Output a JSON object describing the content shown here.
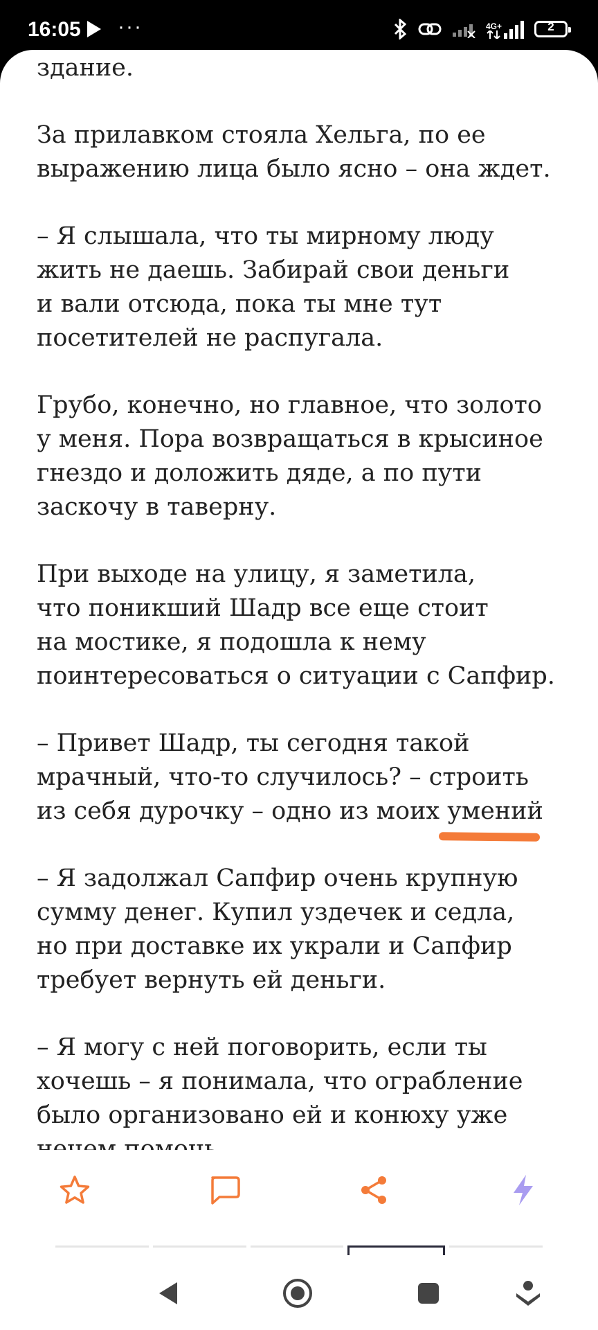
{
  "status_bar": {
    "time": "16:05",
    "more": "···",
    "network_label": "4G+",
    "battery": "2"
  },
  "article": {
    "paragraphs": [
      "я кивнула своим мыслям и вошла в\nздание.",
      "За прилавком стояла Хельга, по ее\nвыражению лица было ясно – она ждет.",
      "– Я слышала, что ты мирному люду\nжить не даешь. Забирай свои деньги\nи вали отсюда, пока ты мне тут\nпосетителей не распугала.",
      "Грубо, конечно, но главное, что золото\nу меня. Пора возвращаться в крысиное\nгнездо и доложить дяде, а по пути\nзаскочу в таверну.",
      "При выходе на улицу, я заметила,\nчто поникший Шадр все еще стоит\nна мостике, я подошла к нему\nпоинтересоваться о ситуации с Сапфир.",
      "– Привет Шадр, ты сегодня такой\nмрачный, что-то случилось? – строить\nиз себя дурочку – одно из моих умений",
      "– Я задолжал Сапфир очень крупную\nсумму денег. Купил уздечек и седла,\nно при доставке их украли и Сапфир\nтребует вернуть ей деньги.",
      "– Я могу с ней поговорить, если ты\nхочешь – я понимала, что ограбление\nбыло организовано ей и конюху уже\nнечем помочь."
    ],
    "underline_color": "#f47b39"
  },
  "toolbar": {
    "accent": "#f47b39",
    "boost_color": "#a99cf0",
    "icons": [
      "star-icon",
      "comment-icon",
      "share-icon",
      "lightning-icon"
    ]
  },
  "navbar": {
    "icons": [
      "back-icon",
      "home-icon",
      "recents-icon",
      "assistant-icon"
    ]
  }
}
